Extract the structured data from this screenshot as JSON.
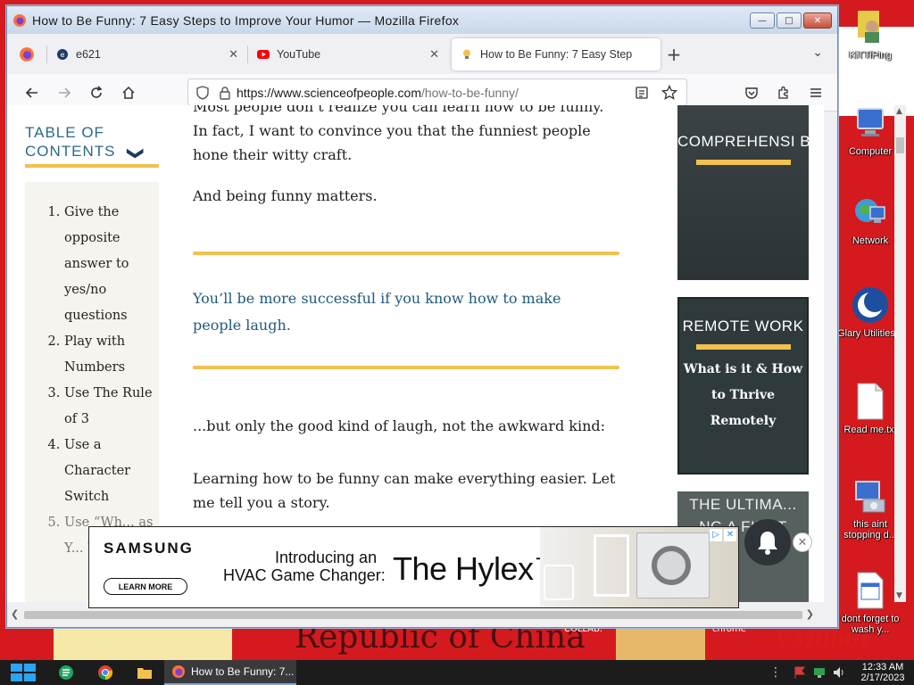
{
  "window": {
    "title": "How to Be Funny: 7 Easy Steps to Improve Your Humor — Mozilla Firefox",
    "min_glyph": "—",
    "max_glyph": "□",
    "close_glyph": "✕"
  },
  "tabs": [
    {
      "title": "e621",
      "close": "✕"
    },
    {
      "title": "YouTube",
      "close": "✕"
    },
    {
      "title": "How to Be Funny: 7 Easy Step",
      "close": "✕"
    }
  ],
  "tabbar": {
    "new_tab": "+",
    "list_tabs": "⌄"
  },
  "urlbar": {
    "domain": "https://www.scienceofpeople.com",
    "path": "/how-to-be-funny/"
  },
  "toc": {
    "heading_line1": "TABLE OF",
    "heading_line2": "CONTENTS",
    "chevron": "❯",
    "items": [
      "Give the opposite answer to yes/no questions",
      "Play with Numbers",
      "Use The Rule of 3",
      "Use a Character Switch",
      "Use “Wh... as Y... We..."
    ]
  },
  "article": {
    "partial_top": "Most people don’t realize you can learn how to be funny. In fact, I want to convince you that the funniest people hone their witty craft.",
    "para_matters": "And being funny matters.",
    "quote": "You’ll be more successful if you know how to make people laugh.",
    "para_laugh": "...but only the good kind of laugh, not the awkward kind:",
    "para_story": "Learning how to be funny can make everything easier. Let me tell you a story."
  },
  "sidebar_cards": [
    {
      "title": "COMPREHENSI BODY LANGUAGE GUIDE (HEAD TO TOE)"
    },
    {
      "title": "REMOTE WORK",
      "subtitle": "What is it & How to Thrive Remotely"
    },
    {
      "title": "THE ULTIMA... NG A FIRST"
    }
  ],
  "ad": {
    "brand": "SAMSUNG",
    "cta": "LEARN MORE",
    "headline_line1": "Introducing an",
    "headline_line2": "HVAC Game Changer:",
    "product": "The Hylex™",
    "adchoices": "▷",
    "ad_close": "✕"
  },
  "notification": {
    "dismiss": "✕"
  },
  "desktop_icons": [
    {
      "label": "KiTTiPing"
    },
    {
      "label": "Computer"
    },
    {
      "label": "Network"
    },
    {
      "label": "Glary Utilities 4"
    },
    {
      "label": "Read me.txt"
    },
    {
      "label": "this aint stopping d..."
    },
    {
      "label": "dont forget to wash y..."
    }
  ],
  "wallpaper": {
    "bottom_text": "Republic of China",
    "small_left": "COLLAB.",
    "small_right": "chrome",
    "scribble": "VM0b0t"
  },
  "taskbar": {
    "task_label": "How to Be Funny: 7...",
    "time": "12:33 AM",
    "date": "2/17/2023"
  },
  "colors": {
    "accent_gold": "#f2c14e",
    "link_blue": "#1e5a7d",
    "toc_blue": "#2a6a8a",
    "card_dark": "#2f3a3d"
  }
}
